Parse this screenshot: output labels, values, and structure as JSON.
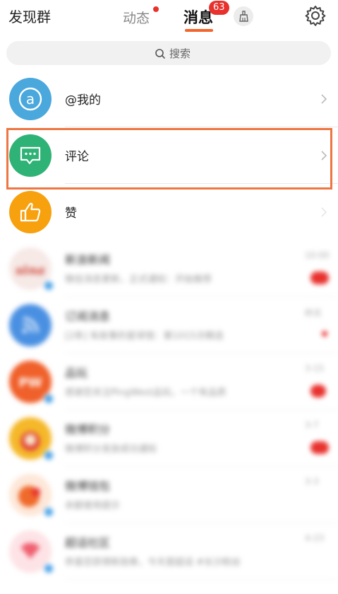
{
  "header": {
    "discover_label": "发现群",
    "tab_dynamic": "动态",
    "tab_messages": "消息",
    "messages_badge": "63",
    "active_color": "#f2652c",
    "badge_color": "#e8312d"
  },
  "search": {
    "placeholder": "搜索"
  },
  "list": {
    "items": [
      {
        "title": "@我的",
        "icon": "at-icon",
        "color": "#4aa8dc"
      },
      {
        "title": "评论",
        "icon": "comment-icon",
        "color": "#2fb276"
      },
      {
        "title": "赞",
        "icon": "thumbs-up-icon",
        "color": "#f7a10f"
      }
    ]
  },
  "blurred": {
    "items": [
      {
        "title": "新浪新闻",
        "preview": "微信消息更新，正式通知：开始推荐",
        "time": "10:00",
        "avatar_color": "#d04a3c"
      },
      {
        "title": "订阅消息",
        "preview": "[2条] 有故事的星球馆：第1015次精选",
        "time": "昨天",
        "avatar_color": "#4a90e2"
      },
      {
        "title": "品玩",
        "preview": "感谢您关注PingWest品玩，一个有品质",
        "time": "3-15",
        "avatar_color": "#f0602a"
      },
      {
        "title": "微博积分",
        "preview": "微博积分发放成功通知",
        "time": "3-7",
        "avatar_color": "#f5b82a"
      },
      {
        "title": "微博钱包",
        "preview": "余额使用提示",
        "time": "3-3",
        "avatar_color": "#f06a2c"
      },
      {
        "title": "超话社区",
        "preview": "恭喜您获得新勋章，今天是超话 #长沙粉丝",
        "time": "4-23",
        "avatar_color": "#f06070"
      }
    ]
  }
}
